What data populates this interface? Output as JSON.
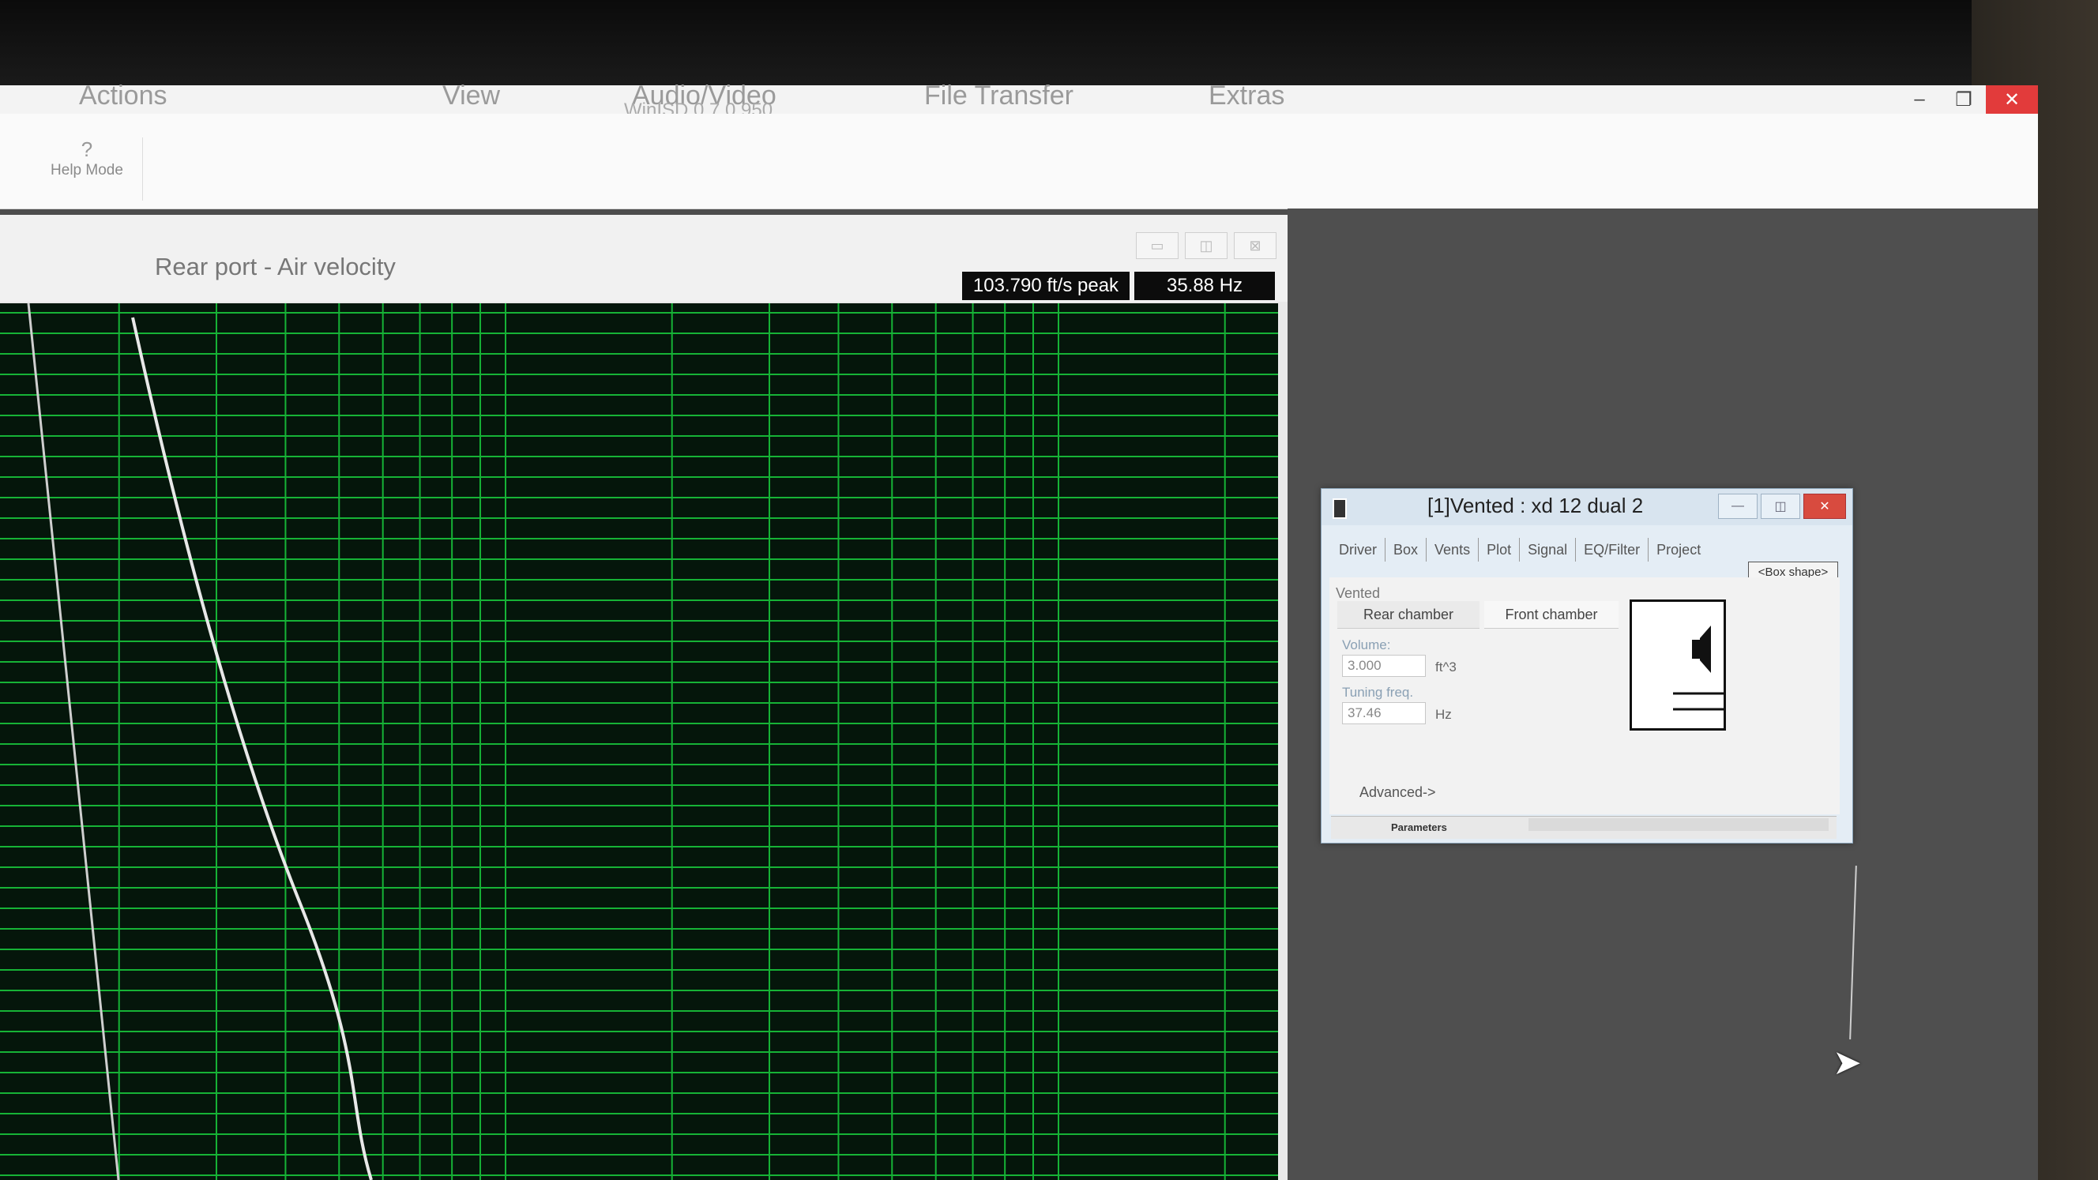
{
  "app": {
    "menu": [
      "Actions",
      "View",
      "Audio/Video",
      "File Transfer",
      "Extras"
    ],
    "subtitle": "WinISD 0.7.0.950",
    "window_controls": {
      "minimize": "–",
      "restore": "❐",
      "close": "✕"
    }
  },
  "ribbon": {
    "help_mode_label": "Help Mode",
    "help_icon": "?"
  },
  "plot_window": {
    "title": "Rear port - Air velocity",
    "readout_peak": "103.790 ft/s peak",
    "readout_freq": "35.88 Hz",
    "colors": {
      "background": "#05160b",
      "grid": "#16b336",
      "curve": "#e8e8e8"
    }
  },
  "vented_dialog": {
    "title": "[1]Vented : xd 12 dual 2",
    "tabs": [
      "Driver",
      "Box",
      "Vents",
      "Plot",
      "Signal",
      "EQ/Filter",
      "Project"
    ],
    "box_shape_button": "<Box shape>",
    "section_label": "Vented",
    "rear_chamber": "Rear chamber",
    "front_chamber": "Front chamber",
    "volume_label": "Volume:",
    "volume_value": "3.000",
    "volume_unit": "ft^3",
    "tuning_label": "Tuning freq.",
    "tuning_value": "37.46",
    "tuning_unit": "Hz",
    "advanced": "Advanced->",
    "bottom_tab": "Parameters"
  }
}
